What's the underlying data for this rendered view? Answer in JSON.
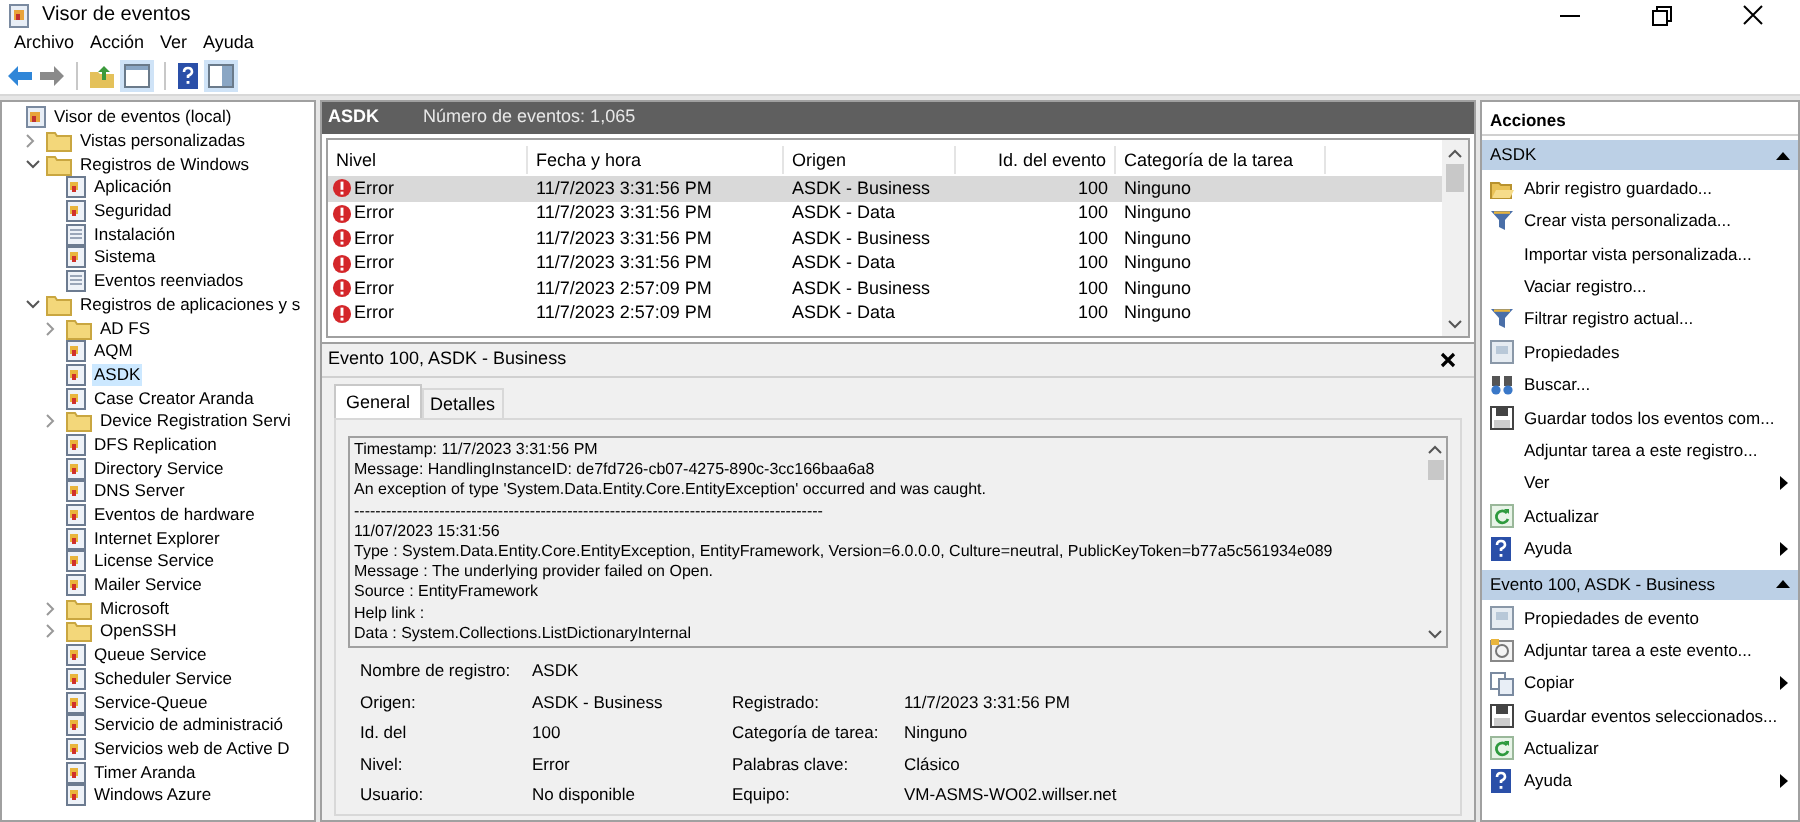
{
  "window": {
    "title": "Visor de eventos"
  },
  "menu": [
    "Archivo",
    "Acción",
    "Ver",
    "Ayuda"
  ],
  "tree": [
    {
      "label": "Visor de eventos (local)",
      "kind": "viewer",
      "selected": false,
      "children": [
        {
          "label": "Vistas personalizadas",
          "kind": "folder",
          "expanded": false,
          "selected": false
        },
        {
          "label": "Registros de Windows",
          "kind": "folder",
          "expanded": true,
          "selected": false,
          "children": [
            {
              "label": "Aplicación",
              "kind": "log",
              "selected": false
            },
            {
              "label": "Seguridad",
              "kind": "log",
              "selected": false
            },
            {
              "label": "Instalación",
              "kind": "plain",
              "selected": false
            },
            {
              "label": "Sistema",
              "kind": "log",
              "selected": false
            },
            {
              "label": "Eventos reenviados",
              "kind": "plain",
              "selected": false
            }
          ]
        },
        {
          "label": "Registros de aplicaciones y s",
          "kind": "folder",
          "expanded": true,
          "selected": false,
          "children": [
            {
              "label": "AD FS",
              "kind": "folder",
              "expanded": false,
              "selected": false
            },
            {
              "label": "AQM",
              "kind": "log",
              "selected": false
            },
            {
              "label": "ASDK",
              "kind": "log",
              "selected": true
            },
            {
              "label": "Case Creator Aranda",
              "kind": "log",
              "selected": false
            },
            {
              "label": "Device Registration Servi",
              "kind": "folder",
              "expanded": false,
              "selected": false
            },
            {
              "label": "DFS Replication",
              "kind": "log",
              "selected": false
            },
            {
              "label": "Directory Service",
              "kind": "log",
              "selected": false
            },
            {
              "label": "DNS Server",
              "kind": "log",
              "selected": false
            },
            {
              "label": "Eventos de hardware",
              "kind": "log",
              "selected": false
            },
            {
              "label": "Internet Explorer",
              "kind": "log",
              "selected": false
            },
            {
              "label": "License Service",
              "kind": "log",
              "selected": false
            },
            {
              "label": "Mailer Service",
              "kind": "log",
              "selected": false
            },
            {
              "label": "Microsoft",
              "kind": "folder",
              "expanded": false,
              "selected": false
            },
            {
              "label": "OpenSSH",
              "kind": "folder",
              "expanded": false,
              "selected": false
            },
            {
              "label": "Queue Service",
              "kind": "log",
              "selected": false
            },
            {
              "label": "Scheduler Service",
              "kind": "log",
              "selected": false
            },
            {
              "label": "Service-Queue",
              "kind": "log",
              "selected": false
            },
            {
              "label": "Servicio de administració",
              "kind": "log",
              "selected": false
            },
            {
              "label": "Servicios web de Active D",
              "kind": "log",
              "selected": false
            },
            {
              "label": "Timer Aranda",
              "kind": "log",
              "selected": false
            },
            {
              "label": "Windows Azure",
              "kind": "log",
              "selected": false
            }
          ]
        }
      ]
    }
  ],
  "log_header": {
    "name": "ASDK",
    "count": "Número de eventos: 1,065"
  },
  "table": {
    "columns": [
      "Nivel",
      "Fecha y hora",
      "Origen",
      "Id. del evento",
      "Categoría de la tarea"
    ],
    "rows": [
      {
        "level": "Error",
        "date": "11/7/2023 3:31:56 PM",
        "source": "ASDK - Business",
        "id": "100",
        "category": "Ninguno",
        "selected": true
      },
      {
        "level": "Error",
        "date": "11/7/2023 3:31:56 PM",
        "source": "ASDK - Data",
        "id": "100",
        "category": "Ninguno",
        "selected": false
      },
      {
        "level": "Error",
        "date": "11/7/2023 3:31:56 PM",
        "source": "ASDK - Business",
        "id": "100",
        "category": "Ninguno",
        "selected": false
      },
      {
        "level": "Error",
        "date": "11/7/2023 3:31:56 PM",
        "source": "ASDK - Data",
        "id": "100",
        "category": "Ninguno",
        "selected": false
      },
      {
        "level": "Error",
        "date": "11/7/2023 2:57:09 PM",
        "source": "ASDK - Business",
        "id": "100",
        "category": "Ninguno",
        "selected": false
      },
      {
        "level": "Error",
        "date": "11/7/2023 2:57:09 PM",
        "source": "ASDK - Data",
        "id": "100",
        "category": "Ninguno",
        "selected": false
      }
    ]
  },
  "detail": {
    "title": "Evento 100, ASDK - Business",
    "tabs": [
      {
        "label": "General",
        "selected": true
      },
      {
        "label": "Detalles",
        "selected": false
      }
    ],
    "message": [
      "Timestamp: 11/7/2023 3:31:56 PM",
      "Message: HandlingInstanceID: de7fd726-cb07-4275-890c-3cc166baa6a8",
      "An exception of type 'System.Data.Entity.Core.EntityException' occurred and was caught.",
      "----------------------------------------------------------------------------------------",
      "11/07/2023 15:31:56",
      "Type : System.Data.Entity.Core.EntityException, EntityFramework, Version=6.0.0.0, Culture=neutral, PublicKeyToken=b77a5c561934e089",
      "Message : The underlying provider failed on Open.",
      "Source : EntityFramework",
      "Help link :",
      "Data : System.Collections.ListDictionaryInternal"
    ],
    "fields": [
      [
        {
          "label": "Nombre de registro:",
          "value": "ASDK"
        }
      ],
      [
        {
          "label": "Origen:",
          "value": "ASDK - Business"
        },
        {
          "label": "Registrado:",
          "value": "11/7/2023 3:31:56 PM"
        }
      ],
      [
        {
          "label": "Id. del",
          "value": "100"
        },
        {
          "label": "Categoría de tarea:",
          "value": "Ninguno"
        }
      ],
      [
        {
          "label": "Nivel:",
          "value": "Error"
        },
        {
          "label": "Palabras clave:",
          "value": "Clásico"
        }
      ],
      [
        {
          "label": "Usuario:",
          "value": "No disponible"
        },
        {
          "label": "Equipo:",
          "value": "VM-ASMS-WO02.willser.net"
        }
      ]
    ]
  },
  "actions": {
    "title": "Acciones",
    "sections": [
      {
        "title": "ASDK",
        "items": [
          {
            "label": "Abrir registro guardado...",
            "kind": "open"
          },
          {
            "label": "Crear vista personalizada...",
            "kind": "filter"
          },
          {
            "label": "Importar vista personalizada..."
          },
          {
            "label": "Vaciar registro..."
          },
          {
            "label": "Filtrar registro actual...",
            "kind": "filter"
          },
          {
            "label": "Propiedades",
            "kind": "props"
          },
          {
            "label": "Buscar...",
            "kind": "find"
          },
          {
            "label": "Guardar todos los eventos com...",
            "kind": "save"
          },
          {
            "label": "Adjuntar tarea a este registro..."
          },
          {
            "label": "Ver",
            "submenu": true
          },
          {
            "label": "Actualizar",
            "kind": "refresh"
          },
          {
            "label": "Ayuda",
            "kind": "help",
            "submenu": true
          }
        ]
      },
      {
        "title": "Evento 100, ASDK - Business",
        "items": [
          {
            "label": "Propiedades de evento",
            "kind": "props"
          },
          {
            "label": "Adjuntar tarea a este evento...",
            "kind": "task"
          },
          {
            "label": "Copiar",
            "kind": "copy",
            "submenu": true
          },
          {
            "label": "Guardar eventos seleccionados...",
            "kind": "save"
          },
          {
            "label": "Actualizar",
            "kind": "refresh"
          },
          {
            "label": "Ayuda",
            "kind": "help",
            "submenu": true
          }
        ]
      }
    ]
  }
}
